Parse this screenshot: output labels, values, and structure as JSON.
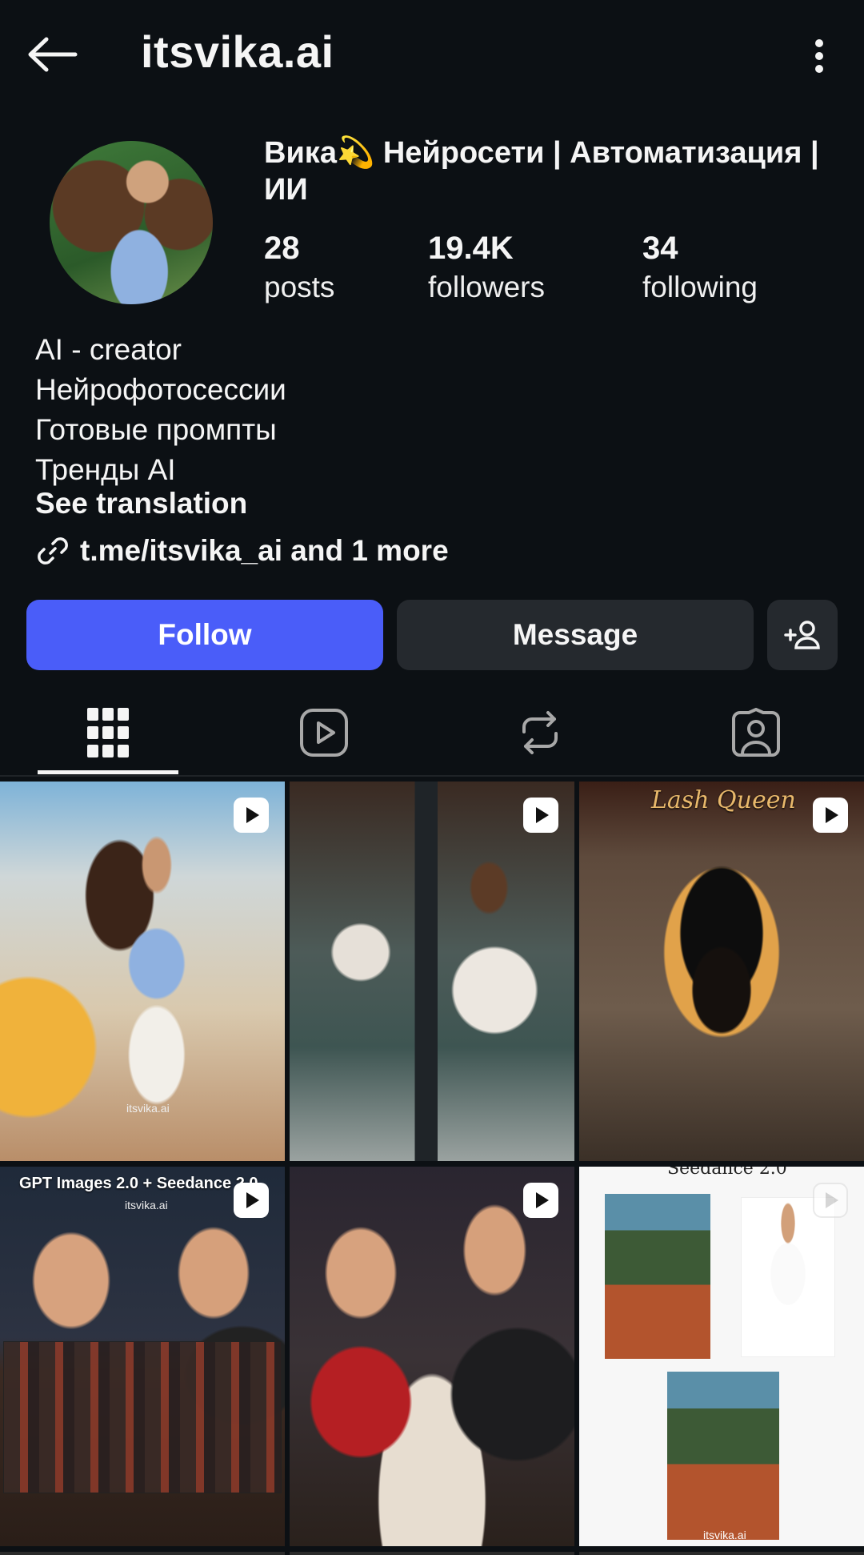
{
  "top_bar": {
    "back_icon": "arrow-left-icon",
    "username": "itsvika.ai",
    "more_icon": "more-vertical-icon"
  },
  "profile": {
    "display_name": "Вика💫 Нейросети | Автоматизация | ИИ",
    "stats": {
      "posts": {
        "count": "28",
        "label": "posts"
      },
      "followers": {
        "count": "19.4K",
        "label": "followers"
      },
      "following": {
        "count": "34",
        "label": "following"
      }
    },
    "bio_lines": [
      "AI - creator",
      "Нейрофотосессии",
      "Готовые промпты",
      "Тренды AI"
    ],
    "see_translation": "See translation",
    "link_text": "t.me/itsvika_ai and 1 more"
  },
  "actions": {
    "follow": "Follow",
    "message": "Message",
    "add_user_icon": "add-person-icon"
  },
  "tabs": [
    {
      "name": "grid",
      "icon": "grid-icon",
      "active": true
    },
    {
      "name": "reels",
      "icon": "reels-icon",
      "active": false
    },
    {
      "name": "reposts",
      "icon": "repost-icon",
      "active": false
    },
    {
      "name": "tagged",
      "icon": "tagged-person-icon",
      "active": false
    }
  ],
  "posts": [
    {
      "caption": "",
      "watermark": "itsvika.ai",
      "is_reel": true
    },
    {
      "caption": "",
      "watermark": "",
      "is_reel": true
    },
    {
      "caption": "Lash Queen",
      "watermark": "",
      "is_reel": true
    },
    {
      "caption": "GPT Images 2.0 + Seedance 2.0",
      "watermark": "itsvika.ai",
      "is_reel": true
    },
    {
      "caption": "",
      "watermark": "",
      "is_reel": true
    },
    {
      "caption": "Seedance 2.0",
      "watermark": "itsvika.ai",
      "is_reel": true
    }
  ],
  "colors": {
    "background": "#0c1014",
    "follow_button": "#4a5df9",
    "secondary_button": "#25292e",
    "text": "#f5f5f5"
  }
}
